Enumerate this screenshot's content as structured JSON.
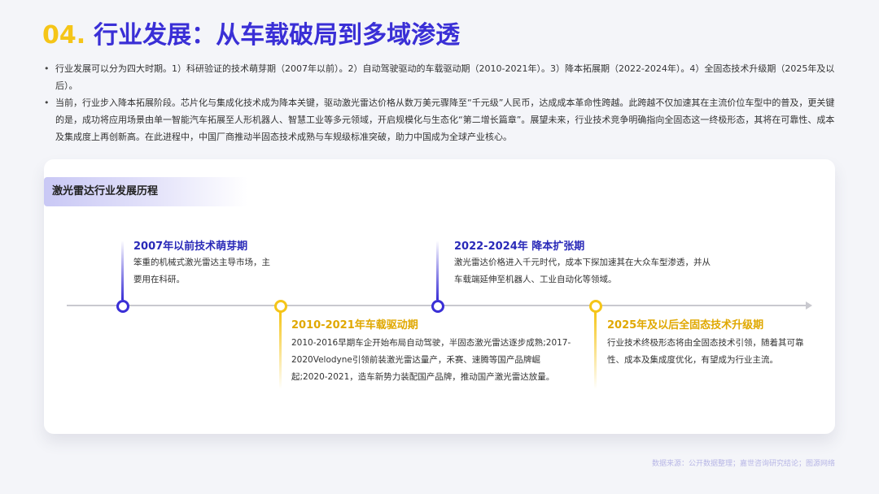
{
  "header": {
    "number": "04.",
    "title": "行业发展：从车载破局到多域渗透"
  },
  "bullets": [
    "行业发展可以分为四大时期。1）科研验证的技术萌芽期（2007年以前）。2）自动驾驶驱动的车载驱动期（2010-2021年）。3）降本拓展期（2022-2024年）。4）全固态技术升级期（2025年及以后）。",
    "当前，行业步入降本拓展阶段。芯片化与集成化技术成为降本关键，驱动激光雷达价格从数万美元骤降至“千元级”人民币，达成成本革命性跨越。此跨越不仅加速其在主流价位车型中的普及，更关键的是，成功将应用场景由单一智能汽车拓展至人形机器人、智慧工业等多元领域，开启规模化与生态化“第二增长篇章”。展望未来，行业技术竞争明确指向全固态这一终极形态，其将在可靠性、成本及集成度上再创新高。在此进程中，中国厂商推动半固态技术成熟与车规级标准突破，助力中国成为全球产业核心。"
  ],
  "card": {
    "label": "激光雷达行业发展历程",
    "phases": [
      {
        "title": "2007年以前技术萌芽期",
        "desc": "笨重的机械式激光雷达主导市场，主要用在科研。"
      },
      {
        "title": "2010-2021年车载驱动期",
        "desc": "2010-2016早期车企开始布局自动驾驶，半固态激光雷达逐步成熟;2017-2020Velodyne引领前装激光雷达量产，禾赛、速腾等国产品牌崛起;2020-2021，造车新势力装配国产品牌，推动国产激光雷达放量。"
      },
      {
        "title": "2022-2024年 降本扩张期",
        "desc": "激光雷达价格进入千元时代，成本下探加速其在大众车型渗透，并从车载端延伸至机器人、工业自动化等领域。"
      },
      {
        "title": "2025年及以后全固态技术升级期",
        "desc": "行业技术终极形态将由全固态技术引领，随着其可靠性、成本及集成度优化，有望成为行业主流。"
      }
    ]
  },
  "footer": {
    "source": "数据来源：公开数据整理；嘉世咨询研究结论；图源网络"
  },
  "colors": {
    "primary": "#3a2fd6",
    "accent": "#f5c518",
    "background": "#f4f5f9"
  }
}
